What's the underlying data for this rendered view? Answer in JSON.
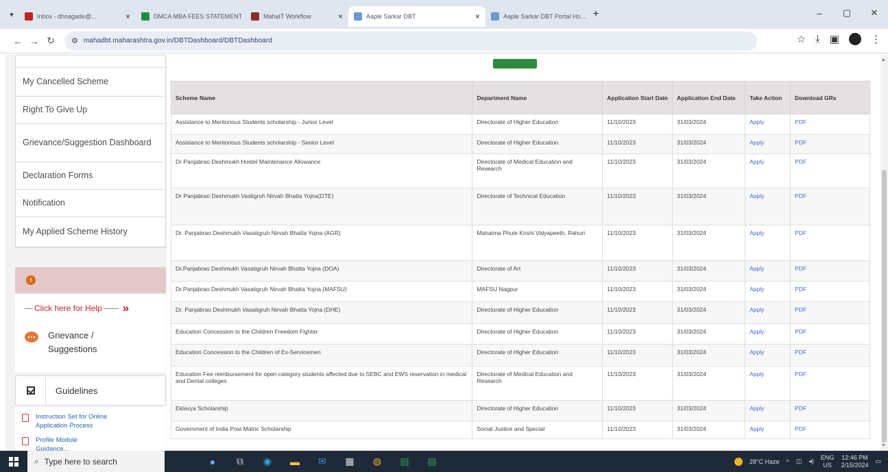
{
  "browser": {
    "tabs": [
      {
        "title": "Inbox - dhnagade@...",
        "favicon_color": "#c5221f",
        "active": false
      },
      {
        "title": "DMCA MBA FEES STATEMENT",
        "favicon_color": "#1e8e3e",
        "active": false
      },
      {
        "title": "MahaIT Workflow",
        "favicon_color": "#8a2b2b",
        "active": false
      },
      {
        "title": "Aaple Sarkar DBT",
        "favicon_color": "#6b9bd1",
        "active": true
      },
      {
        "title": "Aaple Sarkar DBT Portal Ho...",
        "favicon_color": "#6b9bd1",
        "active": false
      }
    ],
    "url": "mahadbt.maharashtra.gov.in/DBTDashboard/DBTDashboard",
    "new_tab": "+",
    "window_controls": {
      "minimize": "–",
      "maximize": "▢",
      "close": "✕"
    }
  },
  "sidebar": {
    "menu": [
      {
        "label": "My Cancelled Scheme",
        "height": 42
      },
      {
        "label": "Right To Give Up",
        "height": 40
      },
      {
        "label": "Grievance/Suggestion Dashboard",
        "height": 56
      },
      {
        "label": "Declaration Forms",
        "height": 40
      },
      {
        "label": "Notification",
        "height": 40
      },
      {
        "label": "My Applied Scheme History",
        "height": 44
      }
    ],
    "info_icon": "!",
    "help_link": "Click here for Help",
    "grievance": "Grievance / Suggestions",
    "guidelines": "Guidelines",
    "doc_links": [
      "Instruction Set for Online Application Process",
      "Profile Module Guidance..."
    ]
  },
  "table": {
    "headers": [
      "Scheme Name",
      "Department Name",
      "Application Start Date",
      "Application End Date",
      "Take Action",
      "Download GRs"
    ],
    "rows": [
      [
        "Assistance to Meritorious Students scholarship - Junior Level",
        "Directorate of Higher Education",
        "11/10/2023",
        "31/03/2024",
        "Apply",
        "PDF"
      ],
      [
        "Assistance to Meritorious Students scholarship - Senior Level",
        "Directorate of Higher Education",
        "11/10/2023",
        "31/03/2024",
        "Apply",
        "PDF"
      ],
      [
        "Dr Panjabrao Deshmukh Hostel Maintenance Allowance",
        "Directorate of Medical Education and Research",
        "11/10/2023",
        "31/03/2024",
        "Apply",
        "PDF"
      ],
      [
        "Dr Panjabrao Deshmukh Vastigruh Nirvah Bhatta Yojna(DTE)",
        "Directorate of Technical Education",
        "11/10/2023",
        "31/03/2024",
        "Apply",
        "PDF"
      ],
      [
        "Dr. Panjabrao Deshmukh Vasatigruh Nirvah Bhatta Yojna (AGR)",
        "Mahatma Phule Krishi Vidyapeeth, Rahuri",
        "11/10/2023",
        "31/03/2024",
        "Apply",
        "PDF"
      ],
      [
        "Dr.Panjabrao Deshmukh Vasatigruh Nirvah Bhatta Yojna (DOA)",
        "Directorate of Art",
        "11/10/2023",
        "31/03/2024",
        "Apply",
        "PDF"
      ],
      [
        "Dr.Panjabrao Deshmukh Vasatigruh Nirvah Bhatta Yojna (MAFSU)",
        "MAFSU Nagpur",
        "11/10/2023",
        "31/03/2024",
        "Apply",
        "PDF"
      ],
      [
        "Dr. Panjabrao Deshmukh Vasatigruh Nirvah Bhatta Yojna (DHE)",
        "Directorate of Higher Education",
        "11/10/2023",
        "31/03/2024",
        "Apply",
        "PDF"
      ],
      [
        "Education Concession to the Children Freedom Fighter",
        "Directorate of Higher Education",
        "11/10/2023",
        "31/03/2024",
        "Apply",
        "PDF"
      ],
      [
        "Education Concession to the Children of Ex-Servicemen",
        "Directorate of Higher Education",
        "11/10/2023",
        "31/03/2024",
        "Apply",
        "PDF"
      ],
      [
        "Education Fee reimbursement for open category students affected due to SEBC and EWS reservation in medical and Dental colleges",
        "Directorate of Medical Education and Research",
        "11/10/2023",
        "31/03/2024",
        "Apply",
        "PDF"
      ],
      [
        "Eklavya Scholarship",
        "Directorate of Higher Education",
        "11/10/2023",
        "31/03/2024",
        "Apply",
        "PDF"
      ],
      [
        "Government of India Post Matric Scholarship",
        "Social Justice and Special",
        "11/10/2023",
        "31/03/2024",
        "Apply",
        "PDF"
      ]
    ]
  },
  "taskbar": {
    "search_placeholder": "Type here to search",
    "weather": "28°C Haze",
    "lang": "ENG",
    "region": "US",
    "time": "12:46 PM",
    "date": "2/15/2024"
  }
}
